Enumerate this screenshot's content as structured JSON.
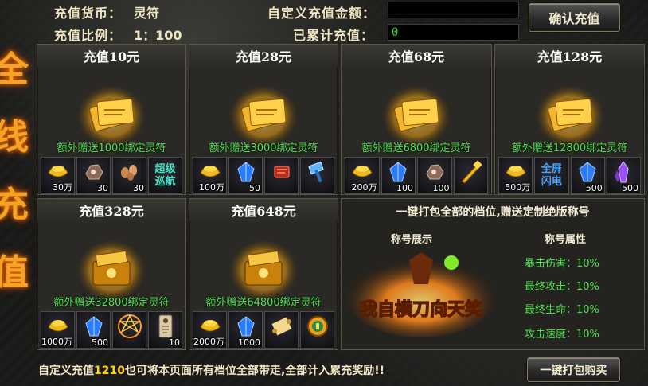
{
  "side_banner": [
    "全",
    "线",
    "充",
    "值"
  ],
  "header": {
    "currency_label": "充值货币：",
    "currency_value": "灵符",
    "ratio_label": "充值比例：",
    "ratio_value": "1：100",
    "custom_amount_label": "自定义充值金额：",
    "custom_amount_value": "",
    "accumulated_label": "已累计充值：",
    "accumulated_value": "0",
    "confirm_button": "确认充值"
  },
  "tiers": [
    {
      "title": "充值10元",
      "bonus": "额外赠送1000绑定灵符",
      "items": [
        {
          "icon": "gold-ingot-icon",
          "qty": "30万"
        },
        {
          "icon": "ore-icon",
          "qty": "30"
        },
        {
          "icon": "seeds-icon",
          "qty": "30"
        },
        {
          "icon": "super-cruise-text",
          "line1": "超级",
          "line2": "巡航",
          "qty": ""
        }
      ]
    },
    {
      "title": "充值28元",
      "bonus": "额外赠送3000绑定灵符",
      "items": [
        {
          "icon": "gold-ingot-icon",
          "qty": "100万"
        },
        {
          "icon": "blue-gem-icon",
          "qty": "50"
        },
        {
          "icon": "red-scroll-icon",
          "qty": ""
        },
        {
          "icon": "hammer-icon",
          "qty": ""
        }
      ]
    },
    {
      "title": "充值68元",
      "bonus": "额外赠送6800绑定灵符",
      "items": [
        {
          "icon": "gold-ingot-icon",
          "qty": "200万"
        },
        {
          "icon": "blue-gem-icon",
          "qty": "100"
        },
        {
          "icon": "ore-icon",
          "qty": "100"
        },
        {
          "icon": "golden-weapon-icon",
          "qty": ""
        }
      ]
    },
    {
      "title": "充值128元",
      "bonus": "额外赠送12800绑定灵符",
      "items": [
        {
          "icon": "gold-ingot-icon",
          "qty": "500万"
        },
        {
          "icon": "fullscreen-flash-text",
          "line1": "全屏",
          "line2": "闪电",
          "qty": ""
        },
        {
          "icon": "blue-gem-icon",
          "qty": "500"
        },
        {
          "icon": "purple-crystal-icon",
          "qty": "500"
        }
      ]
    },
    {
      "title": "充值328元",
      "bonus": "额外赠送32800绑定灵符",
      "items": [
        {
          "icon": "gold-ingot-icon",
          "qty": "1000万"
        },
        {
          "icon": "blue-gem-icon",
          "qty": "500"
        },
        {
          "icon": "magic-circle-icon",
          "qty": ""
        },
        {
          "icon": "talisman-icon",
          "qty": "10"
        }
      ]
    },
    {
      "title": "充值648元",
      "bonus": "额外赠送64800绑定灵符",
      "items": [
        {
          "icon": "gold-ingot-icon",
          "qty": "2000万"
        },
        {
          "icon": "blue-gem-icon",
          "qty": "1000"
        },
        {
          "icon": "scroll-icon",
          "qty": ""
        },
        {
          "icon": "fortune-medal-icon",
          "qty": ""
        }
      ]
    }
  ],
  "bundle": {
    "title": "一键打包全部的档位,赠送定制绝版称号",
    "showcase_label": "称号展示",
    "attributes_label": "称号属性",
    "attributes": [
      {
        "name": "暴击伤害：",
        "value": "10%"
      },
      {
        "name": "最终攻击：",
        "value": "10%"
      },
      {
        "name": "最终生命：",
        "value": "10%"
      },
      {
        "name": "攻击速度：",
        "value": "10%"
      }
    ],
    "title_art_text": "我自横刀向天笑"
  },
  "footer": {
    "text_before": "自定义充值",
    "amount": "1210",
    "text_after": "也可将本页面所有档位全部带走,全部计入累充奖励!!",
    "buy_button": "一键打包购买"
  },
  "colors": {
    "bonus_green": "#52e052",
    "gold": "#ffd200",
    "accent_orange": "#f4a326"
  }
}
